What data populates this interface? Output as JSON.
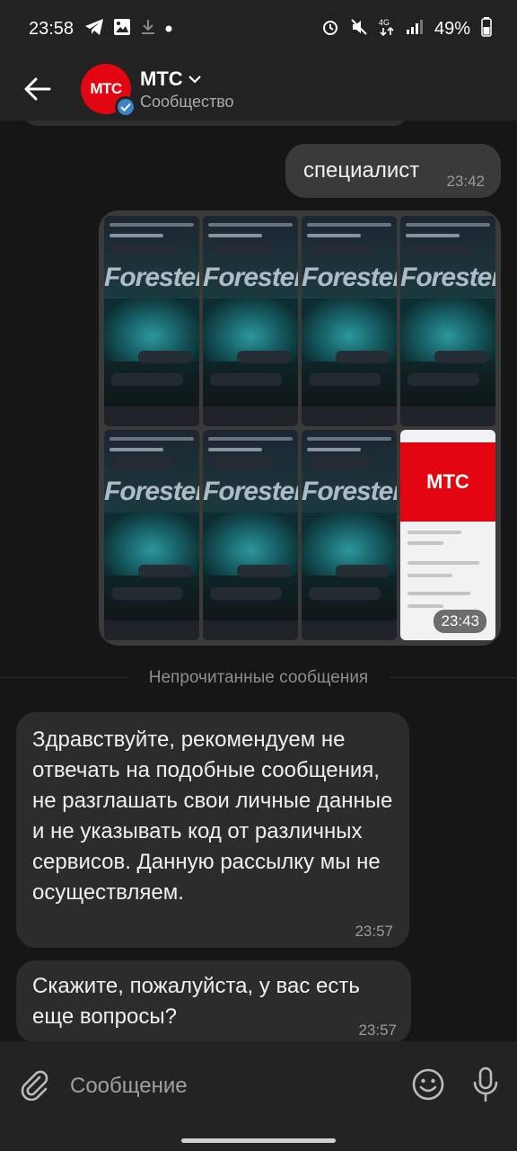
{
  "status_bar": {
    "time": "23:58",
    "battery_percent": "49%",
    "network": "4G"
  },
  "header": {
    "back_icon": "arrow-left-icon",
    "avatar_text": "МТС",
    "name": "МТС",
    "subtitle": "Сообщество"
  },
  "messages": [
    {
      "direction": "out",
      "type": "text",
      "text": "специалист",
      "time": "23:42"
    },
    {
      "direction": "out",
      "type": "photo-album",
      "count": 8,
      "time": "23:43",
      "thumbnails": [
        {
          "word": "Forester"
        },
        {
          "word": "Forester"
        },
        {
          "word": "Forester"
        },
        {
          "word": "Forester"
        },
        {
          "word": "Forester"
        },
        {
          "word": "Forester"
        },
        {
          "word": "Forester"
        },
        {
          "logo": "МТС"
        }
      ]
    },
    {
      "direction": "in",
      "type": "text",
      "text": "Здравствуйте, рекомендуем не отвечать на подобные сообщения, не разглашать свои личные данные и не указывать код от различных сервисов. Данную рассылку мы не осуществляем.",
      "time": "23:57"
    },
    {
      "direction": "in",
      "type": "text",
      "text": "Скажите, пожалуйста, у вас есть еще вопросы?",
      "time": "23:57"
    }
  ],
  "unread_divider": "Непрочитанные сообщения",
  "composer": {
    "placeholder": "Сообщение"
  },
  "colors": {
    "brand_red": "#e30611",
    "verified_blue": "#3b82c8",
    "bubble_out": "#3a3a3a",
    "bubble_in": "#2c2c2c",
    "background": "#161616"
  }
}
